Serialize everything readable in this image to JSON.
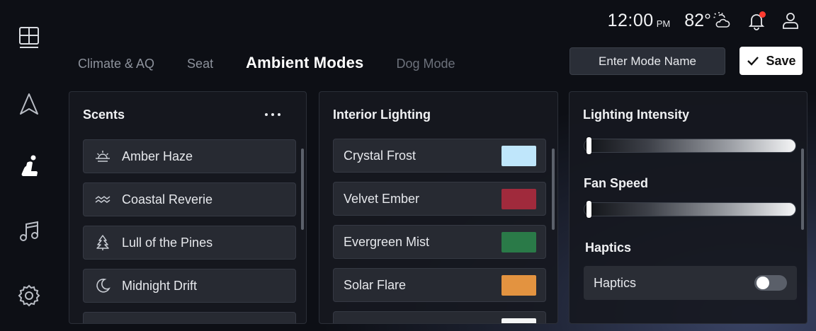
{
  "status": {
    "time": "12:00",
    "ampm": "PM",
    "temperature": "82°"
  },
  "tabs": [
    {
      "label": "Climate & AQ"
    },
    {
      "label": "Seat"
    },
    {
      "label": "Ambient Modes"
    },
    {
      "label": "Dog Mode"
    }
  ],
  "mode_name": {
    "value": "Enter Mode Name"
  },
  "save": {
    "label": "Save"
  },
  "scents": {
    "title": "Scents",
    "items": [
      {
        "label": "Amber Haze",
        "icon": "sunrise-icon"
      },
      {
        "label": "Coastal Reverie",
        "icon": "waves-icon"
      },
      {
        "label": "Lull of the Pines",
        "icon": "pine-tree-icon"
      },
      {
        "label": "Midnight Drift",
        "icon": "moon-icon"
      }
    ]
  },
  "lighting": {
    "title": "Interior Lighting",
    "items": [
      {
        "label": "Crystal Frost",
        "color": "#bfe6fb"
      },
      {
        "label": "Velvet Ember",
        "color": "#a02a3c"
      },
      {
        "label": "Evergreen Mist",
        "color": "#2a7a48"
      },
      {
        "label": "Solar Flare",
        "color": "#e39340"
      }
    ]
  },
  "controls": {
    "intensity_label": "Lighting Intensity",
    "intensity_value": 0,
    "fan_label": "Fan Speed",
    "fan_value": 0,
    "haptics_section": "Haptics",
    "haptics_label": "Haptics",
    "haptics_on": false
  }
}
